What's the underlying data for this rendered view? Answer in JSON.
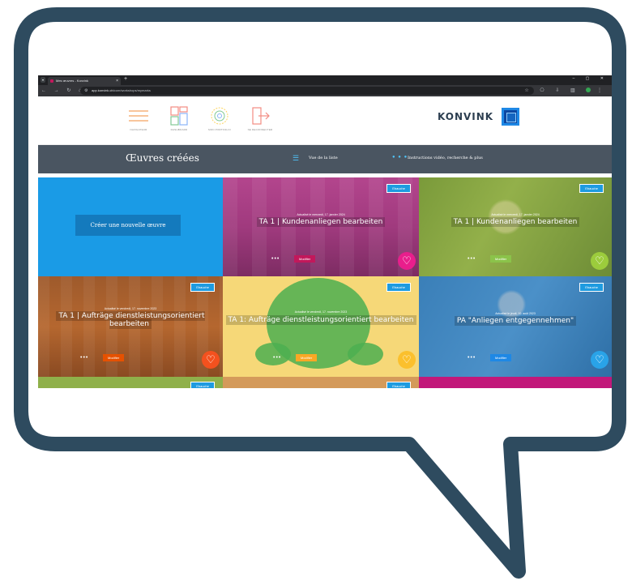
{
  "browser": {
    "tab_title": "Mes œuvres - Konvink",
    "url_host": "app.konvink.ch",
    "url_path": "/com/workshops/mymarks"
  },
  "header": {
    "nav": [
      {
        "label": "NAVIGATEUR"
      },
      {
        "label": "DASHBOARD"
      },
      {
        "label": "MON PORTFOLIO"
      },
      {
        "label": "SE DECONNECTER"
      }
    ],
    "logo_text": "KONVINK"
  },
  "toolbar": {
    "title": "Œuvres créées",
    "list_view": "Vue de la liste",
    "instructions": "Instructions vidéo, recherche & plus"
  },
  "create_button": "Créer une nouvelle œuvre",
  "cards": [
    {
      "badge": "Ebauche",
      "updated": "Actualisé le mercredi, 17. janvier 2024",
      "title": "TA 1 | Kundenanliegen bearbeiten",
      "modify": "Modifier"
    },
    {
      "badge": "Ebauche",
      "updated": "Actualisé le mercredi, 17. janvier 2024",
      "title": "TA 1 | Kundenanliegen bearbeiten",
      "modify": "Modifier"
    },
    {
      "badge": "Ebauche",
      "updated": "Actualisé le vendredi, 17. novembre 2023",
      "title": "TA 1 | Aufträge dienstleistungsorientiert bearbeiten",
      "modify": "Modifier"
    },
    {
      "badge": "Ebauche",
      "updated": "Actualisé le vendredi, 17. novembre 2023",
      "title": "TA 1: Aufträge dienstleistungsorientiert bearbeiten",
      "modify": "Modifier"
    },
    {
      "badge": "Ebauche",
      "updated": "Actualisé le jeudi, 10. août 2023",
      "title": "PA \"Anliegen entgegennehmen\"",
      "modify": "Modifier"
    },
    {
      "badge": "Ebauche"
    },
    {
      "badge": "Ebauche"
    }
  ],
  "colors": {
    "bubble_border": "#2e4b5f",
    "create_bg": "#1a9be6",
    "toolbar_bg": "#4a5561",
    "badge": "#1e9be0"
  }
}
